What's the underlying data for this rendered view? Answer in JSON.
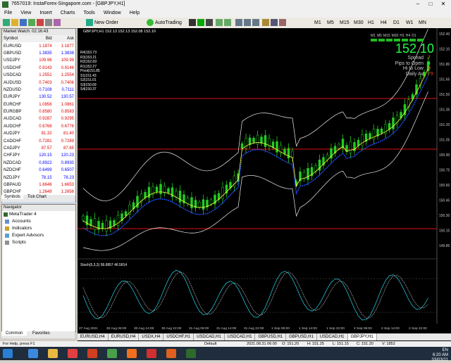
{
  "window": {
    "title": "7657019: InstaForex-Singapore.com - [GBPJPY,H1]"
  },
  "menu": [
    "File",
    "View",
    "Insert",
    "Charts",
    "Tools",
    "Window",
    "Help"
  ],
  "toolbar": {
    "new_order": "New Order",
    "autotrading": "AutoTrading",
    "timeframes": [
      "M1",
      "M5",
      "M15",
      "M30",
      "H1",
      "H4",
      "D1",
      "W1",
      "MN"
    ]
  },
  "market_watch": {
    "title": "Market Watch: 02:16:43",
    "columns": [
      "Symbol",
      "Bid",
      "Ask"
    ],
    "rows": [
      {
        "s": "EURUSD",
        "b": "1.1874",
        "a": "1.1877",
        "d": "dn"
      },
      {
        "s": "GBPUSD",
        "b": "1.3835",
        "a": "1.3838",
        "d": "up"
      },
      {
        "s": "USDJPY",
        "b": "109.96",
        "a": "109.99",
        "d": "dn"
      },
      {
        "s": "USDCHF",
        "b": "0.9143",
        "a": "0.9146",
        "d": "dn"
      },
      {
        "s": "USDCAD",
        "b": "1.2551",
        "a": "1.2554",
        "d": "dn"
      },
      {
        "s": "AUDUSD",
        "b": "0.7403",
        "a": "0.7406",
        "d": "dn"
      },
      {
        "s": "NZDUSD",
        "b": "0.7108",
        "a": "0.7111",
        "d": "up"
      },
      {
        "s": "EURJPY",
        "b": "130.52",
        "a": "130.57",
        "d": "up"
      },
      {
        "s": "EURCHF",
        "b": "1.0856",
        "a": "1.0861",
        "d": "dn"
      },
      {
        "s": "EURGBP",
        "b": "0.8580",
        "a": "0.8583",
        "d": "dn"
      },
      {
        "s": "AUDCAD",
        "b": "0.9287",
        "a": "0.9295",
        "d": "dn"
      },
      {
        "s": "AUDCHF",
        "b": "0.6768",
        "a": "0.6776",
        "d": "dn"
      },
      {
        "s": "AUDJPY",
        "b": "81.32",
        "a": "81.40",
        "d": "dn"
      },
      {
        "s": "CADCHF",
        "b": "0.7281",
        "a": "0.7289",
        "d": "dn"
      },
      {
        "s": "CADJPY",
        "b": "87.57",
        "a": "87.65",
        "d": "dn"
      },
      {
        "s": "CHFJPY",
        "b": "120.15",
        "a": "120.23",
        "d": "up"
      },
      {
        "s": "NZDCAD",
        "b": "0.8922",
        "a": "0.8930",
        "d": "up"
      },
      {
        "s": "NZDCHF",
        "b": "0.6499",
        "a": "0.6507",
        "d": "up"
      },
      {
        "s": "NZDJPY",
        "b": "78.15",
        "a": "78.23",
        "d": "up"
      },
      {
        "s": "GBPAUD",
        "b": "1.6646",
        "a": "1.6653",
        "d": "dn"
      },
      {
        "s": "GBPCHF",
        "b": "1.2649",
        "a": "1.2656",
        "d": "dn"
      },
      {
        "s": "GBPJPY",
        "b": "152.10",
        "a": "152.17",
        "d": "up"
      }
    ],
    "tabs": [
      "Symbols",
      "Tick Chart"
    ]
  },
  "navigator": {
    "title": "Navigator",
    "items": [
      "MetaTrader 4",
      "Accounts",
      "Indicators",
      "Expert Advisors",
      "Scripts"
    ],
    "tabs": [
      "Common",
      "Favorites"
    ]
  },
  "chart": {
    "header": "GBPJPY,H1  152.13 152.13 152.08 152.10",
    "panel": {
      "tfs": [
        "M1",
        "M5",
        "M15",
        "M30",
        "H1",
        "H4",
        "D1"
      ],
      "price": "152.10",
      "rows": [
        [
          "Spread",
          "7"
        ],
        [
          "Pips to Open",
          "4"
        ],
        [
          "Hi to Low",
          "9"
        ],
        [
          "Daily Av",
          "79"
        ]
      ]
    },
    "levels": [
      "R4|153.73",
      "R3|153.21",
      "R2|152.69",
      "R1|152.27",
      "Pivot|151.85",
      "S1|151.43",
      "S2|151.01",
      "S3|150.69",
      "S4|150.37"
    ],
    "price_ticks": [
      "152.40",
      "152.10",
      "151.80",
      "151.65",
      "151.50",
      "151.35",
      "151.20",
      "151.05",
      "150.90",
      "150.75",
      "150.60",
      "150.45",
      "150.30",
      "150.15",
      "149.85"
    ],
    "oscillator_label": "Stoch(5,3,3) 58.6857 46.5814",
    "time_ticks": [
      "27 Aug 2021",
      "30 Aug 06:00",
      "30 Aug 14:00",
      "30 Aug 22:00",
      "31 Aug 06:00",
      "31 Aug 14:00",
      "31 Aug 22:00",
      "1 Sep 06:00",
      "1 Sep 14:00",
      "1 Sep 22:00",
      "2 Sep 06:00",
      "2 Sep 14:00",
      "2 Sep 22:00"
    ],
    "tabs": [
      "EURUSD,H4",
      "EURUSD,H4",
      "USDX,H4",
      "USDCHF,H1",
      "USDCAD,H1",
      "USDCAD,H1",
      "GBPUSD,H1",
      "GBPUSD,H1",
      "USDCAD,H1",
      "GBPJPY,H1"
    ],
    "active_tab": "GBPJPY,H1"
  },
  "status": {
    "help": "For Help, press F1",
    "profile": "Default",
    "time": "2021.08.31 06:00",
    "o": "O: 151.20",
    "h": "H: 151.25",
    "l": "L: 151.15",
    "c": "C: 151.20",
    "v": "V: 1852"
  },
  "tray": {
    "lang": "EN",
    "time": "6:20 AM",
    "date": "03/03/21"
  }
}
